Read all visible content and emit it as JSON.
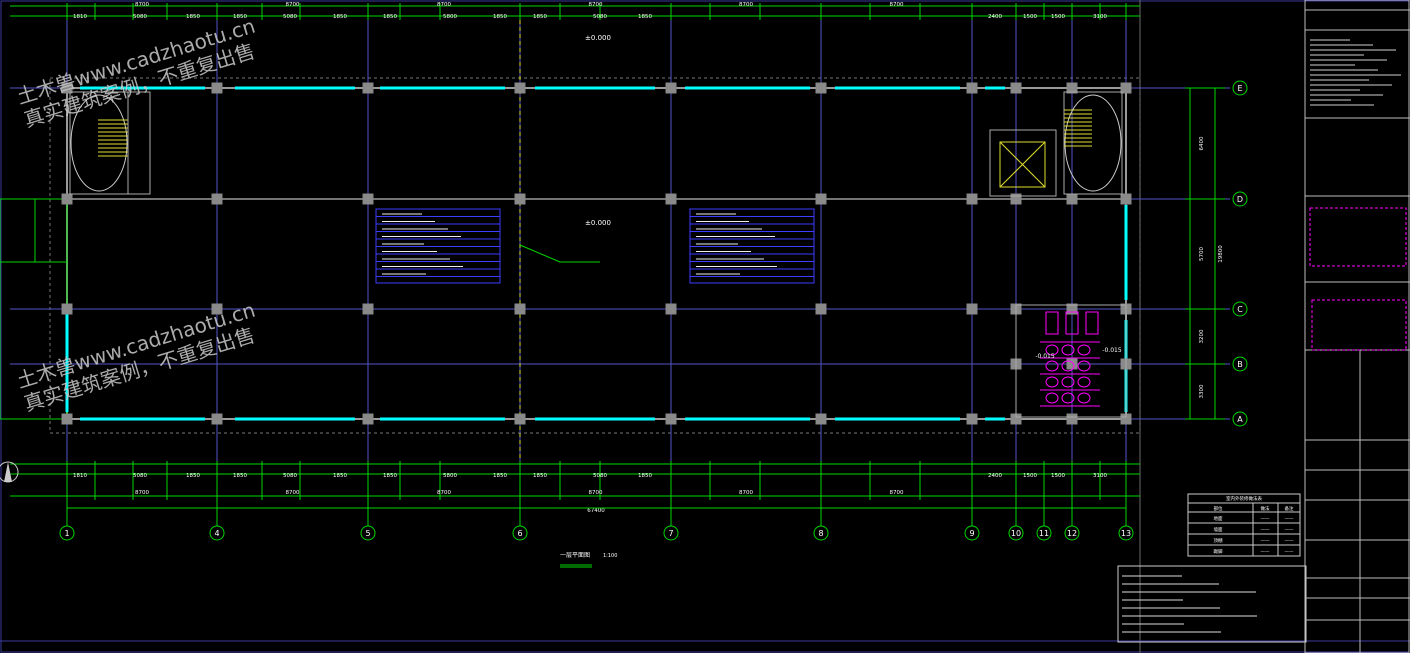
{
  "watermarks": [
    {
      "line1": "土木兽www.cadzhaotu.cn",
      "line2": "真实建筑案例，不重复出售"
    },
    {
      "line1": "土木兽www.cadzhaotu.cn",
      "line2": "真实建筑案例，不重复出售"
    }
  ],
  "drawing": {
    "title": "一层平面图",
    "scale": "1:100",
    "elevation_main": "±0.000",
    "elevation_toilet": "-0.015",
    "total_length": "67400",
    "total_depth": "19800"
  },
  "axes": {
    "bottom": [
      "1",
      "4",
      "5",
      "6",
      "7",
      "8",
      "9",
      "10",
      "11",
      "12",
      "13"
    ],
    "right": [
      "E",
      "D",
      "C",
      "B",
      "A"
    ]
  },
  "dims": {
    "bays": [
      "8700",
      "8700",
      "8700",
      "8700",
      "8700",
      "8700",
      "8700"
    ],
    "right_spans": [
      "6400",
      "5700",
      "3200",
      "3300"
    ],
    "top_row": [
      "1810",
      "5080",
      "1850",
      "1850",
      "5080",
      "1850",
      "1850",
      "5800",
      "1850",
      "1850",
      "5080",
      "1850",
      "2400",
      "1500",
      "1500",
      "3100"
    ]
  },
  "colors": {
    "grid": "#5353c8",
    "wall": "#9a9a9a",
    "window": "#00ffff",
    "dim": "#00d600",
    "text": "#ffffff",
    "note_box": "#3d3dff",
    "toilet": "#ff00ff",
    "axis_circle": "#00d600",
    "yellow": "#dede2e"
  },
  "legend_table": {
    "title": "室内外装修做法表",
    "headers": [
      "部位",
      "做法",
      "备注"
    ],
    "rows": [
      [
        "地面",
        "——",
        "——"
      ],
      [
        "墙面",
        "——",
        "——"
      ],
      [
        "顶棚",
        "——",
        "——"
      ],
      [
        "踢脚",
        "——",
        "——"
      ]
    ]
  }
}
